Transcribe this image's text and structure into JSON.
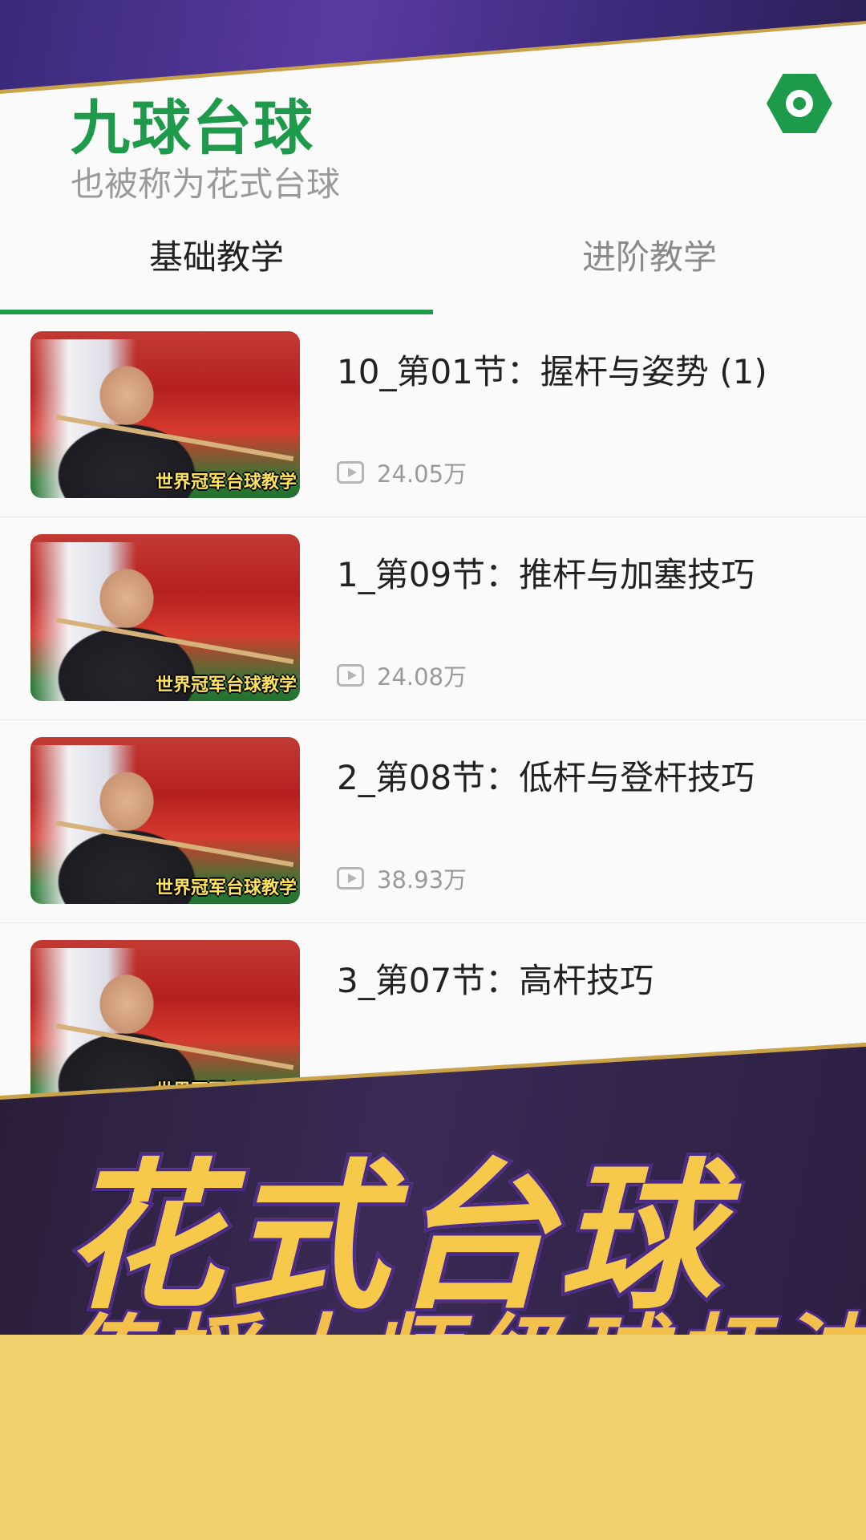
{
  "header": {
    "title": "九球台球",
    "subtitle": "也被称为花式台球"
  },
  "tabs": [
    {
      "label": "基础教学",
      "active": true
    },
    {
      "label": "进阶教学",
      "active": false
    }
  ],
  "videos": [
    {
      "title": "10_第01节：握杆与姿势 (1)",
      "views": "24.05万",
      "thumb_text": "世界冠军台球教学"
    },
    {
      "title": "1_第09节：推杆与加塞技巧",
      "views": "24.08万",
      "thumb_text": "世界冠军台球教学"
    },
    {
      "title": "2_第08节：低杆与登杆技巧",
      "views": "38.93万",
      "thumb_text": "世界冠军台球教学"
    },
    {
      "title": "3_第07节：高杆技巧",
      "views": "",
      "thumb_text": "世界冠军台球教学"
    }
  ],
  "banner": {
    "title": "花式台球",
    "subtitle": "传授大师级球杆法"
  },
  "colors": {
    "accent": "#1d9a4a",
    "banner_purple": "#3a2a55",
    "banner_gold": "#f6c94a"
  },
  "icons": {
    "settings": "hexagon-settings-icon",
    "views": "play-icon"
  }
}
